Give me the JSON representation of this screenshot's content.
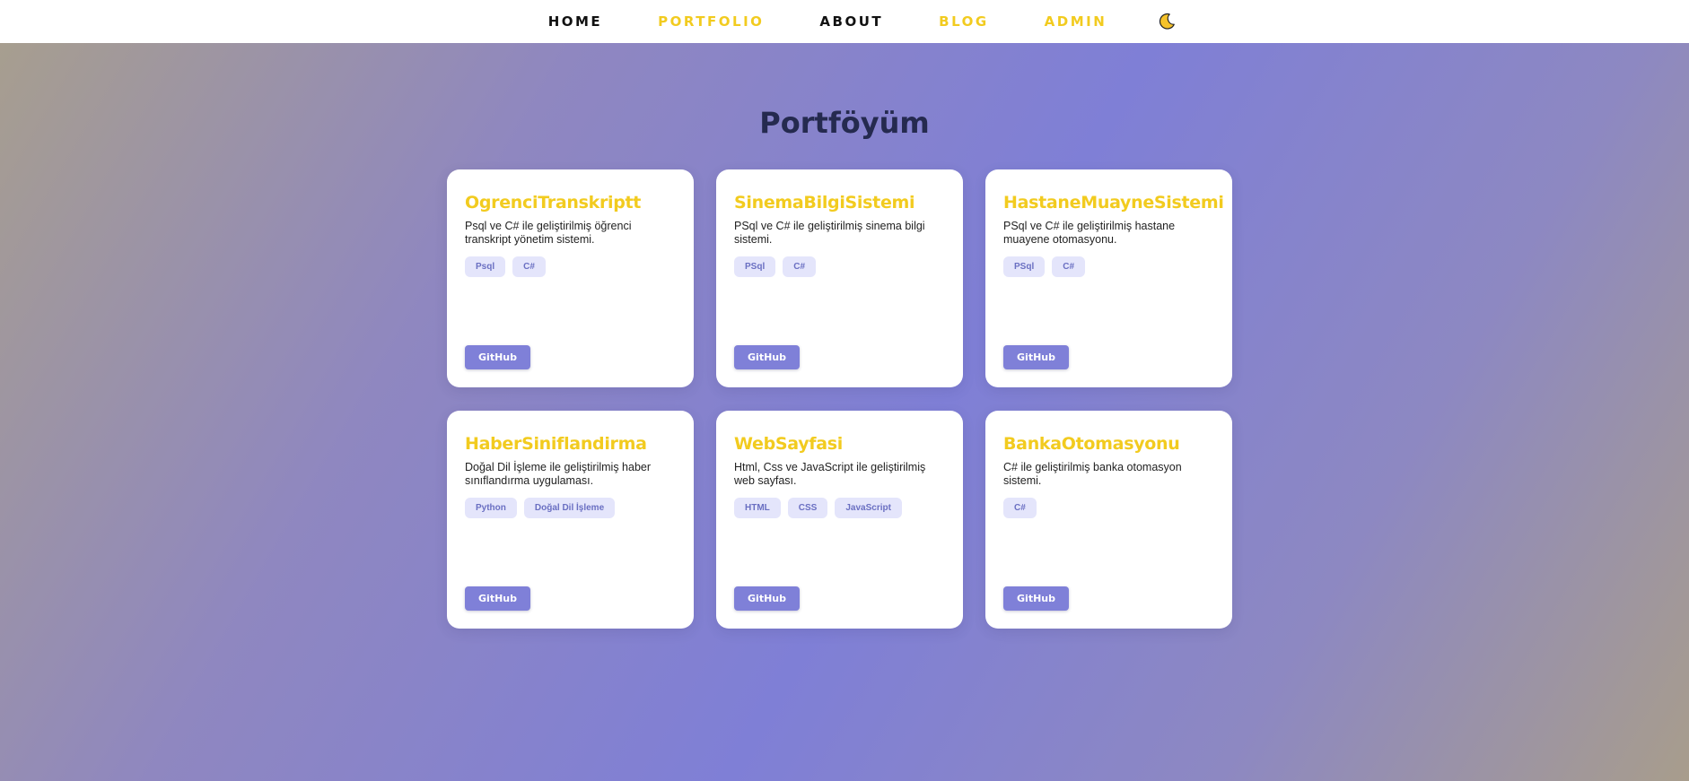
{
  "nav": {
    "items": [
      {
        "label": "HOME",
        "color": "#111111"
      },
      {
        "label": "PORTFOLIO",
        "color": "#f2cb1f"
      },
      {
        "label": "ABOUT",
        "color": "#111111"
      },
      {
        "label": "BLOG",
        "color": "#f2cb1f"
      },
      {
        "label": "ADMIN",
        "color": "#f2cb1f"
      }
    ],
    "theme_toggle_icon": "moon-icon"
  },
  "page": {
    "title": "Portföyüm"
  },
  "projects": [
    {
      "title": "OgrenciTranskriptt",
      "description": "Psql ve C# ile geliştirilmiş öğrenci transkript yönetim sistemi.",
      "tags": [
        "Psql",
        "C#"
      ],
      "button": "GitHub"
    },
    {
      "title": "SinemaBilgiSistemi",
      "description": "PSql ve C# ile geliştirilmiş sinema bilgi sistemi.",
      "tags": [
        "PSql",
        "C#"
      ],
      "button": "GitHub"
    },
    {
      "title": "HastaneMuayneSistemi",
      "description": "PSql ve C# ile geliştirilmiş hastane muayene otomasyonu.",
      "tags": [
        "PSql",
        "C#"
      ],
      "button": "GitHub"
    },
    {
      "title": "HaberSiniflandirma",
      "description": "Doğal Dil İşleme ile geliştirilmiş haber sınıflandırma uygulaması.",
      "tags": [
        "Python",
        "Doğal Dil İşleme"
      ],
      "button": "GitHub"
    },
    {
      "title": "WebSayfasi",
      "description": "Html, Css ve JavaScript ile geliştirilmiş web sayfası.",
      "tags": [
        "HTML",
        "CSS",
        "JavaScript"
      ],
      "button": "GitHub"
    },
    {
      "title": "BankaOtomasyonu",
      "description": "C# ile geliştirilmiş banka otomasyon sistemi.",
      "tags": [
        "C#"
      ],
      "button": "GitHub"
    }
  ],
  "colors": {
    "accent": "#f2cb1f",
    "button": "#7f80d8",
    "tag_bg": "#e4e5fb",
    "tag_text": "#6a6fc2",
    "title": "#252a4f"
  }
}
